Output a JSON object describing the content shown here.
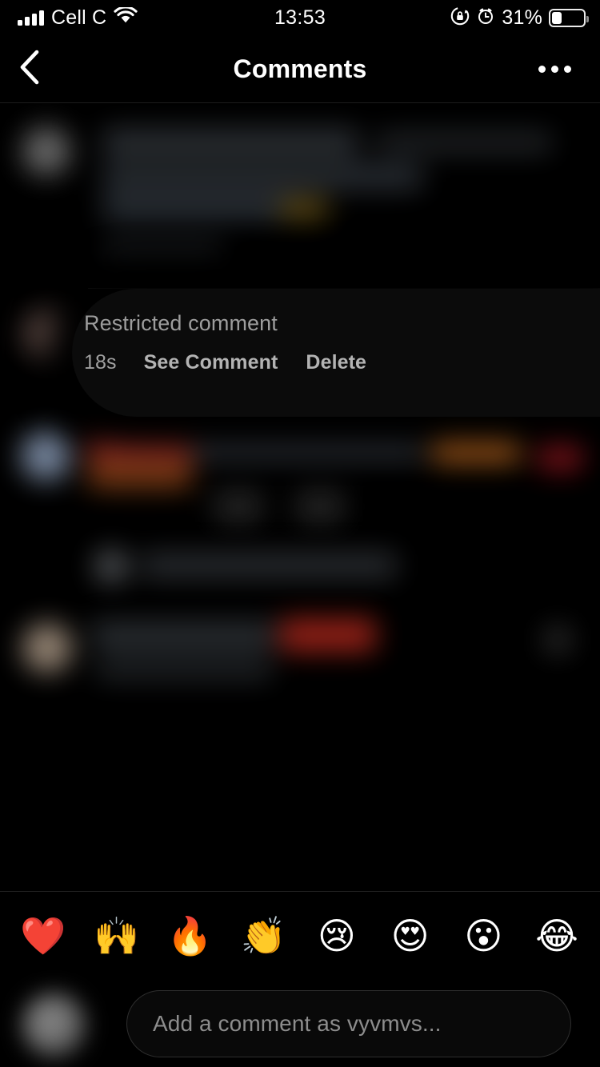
{
  "status_bar": {
    "carrier": "Cell C",
    "time": "13:53",
    "battery_percent": "31%",
    "icons": [
      "signal-bars-icon",
      "wifi-icon",
      "rotation-lock-icon",
      "alarm-clock-icon",
      "battery-icon"
    ]
  },
  "nav": {
    "title": "Comments",
    "back_icon": "chevron-left-icon",
    "more_icon": "ellipsis-icon"
  },
  "selected_comment": {
    "label": "Restricted comment",
    "timestamp": "18s",
    "see_comment_label": "See Comment",
    "delete_label": "Delete"
  },
  "emoji_bar": {
    "items": [
      {
        "glyph": "❤️",
        "name": "heart-emoji"
      },
      {
        "glyph": "🙌",
        "name": "raising-hands-emoji"
      },
      {
        "glyph": "🔥",
        "name": "fire-emoji"
      },
      {
        "glyph": "👏",
        "name": "clapping-hands-emoji"
      },
      {
        "glyph": "😢",
        "name": "crying-face-emoji"
      },
      {
        "glyph": "😍",
        "name": "heart-eyes-emoji"
      },
      {
        "glyph": "😮",
        "name": "surprised-face-emoji"
      },
      {
        "glyph": "😂",
        "name": "tears-of-joy-emoji"
      }
    ]
  },
  "composer": {
    "placeholder": "Add a comment as vyvmvs...",
    "value": ""
  },
  "hidden_comments": [
    {
      "name": "comment-row-1",
      "obscured": true
    },
    {
      "name": "comment-row-2",
      "obscured": true
    },
    {
      "name": "comment-row-3",
      "obscured": true
    },
    {
      "name": "comment-row-4",
      "obscured": true
    },
    {
      "name": "comment-row-5",
      "obscured": true
    }
  ],
  "colors": {
    "background": "#000000",
    "text_primary": "#ffffff",
    "text_secondary": "#9d9d9d",
    "divider": "#1b1b1b"
  }
}
